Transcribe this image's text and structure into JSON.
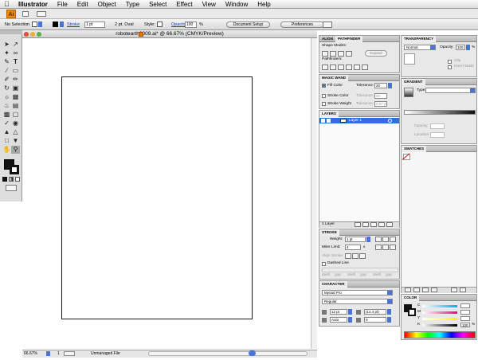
{
  "menubar": {
    "app": "Illustrator",
    "items": [
      "File",
      "Edit",
      "Object",
      "Type",
      "Select",
      "Effect",
      "View",
      "Window",
      "Help"
    ]
  },
  "appbar": {
    "logo": "Ai"
  },
  "control": {
    "selection": "No Selection",
    "stroke_label": "Stroke",
    "stroke_weight": "1 pt",
    "brush": "2 pt. Oval",
    "style_label": "Style:",
    "opacity_label": "Opacity:",
    "opacity_value": "100",
    "percent": "%",
    "document_setup": "Document Setup",
    "preferences": "Preferences"
  },
  "document": {
    "tab_title": "robotearth3009.ai* @ 66.67% (CMYK/Preview)"
  },
  "status": {
    "zoom": "66.67%",
    "page": "1",
    "info": "Unmanaged File"
  },
  "align_panel": {
    "tabs": [
      "ALIGN",
      "PATHFINDER"
    ],
    "shape_modes": "Shape Modes:",
    "expand": "Expand",
    "pathfinders": "Pathfinders:"
  },
  "magic_wand": {
    "title": "MAGIC WAND",
    "fill_color": "Fill Color",
    "tolerance": "Tolerance:",
    "tolerance_value": "20",
    "stroke_color": "Stroke Color",
    "stroke_tolerance": "20",
    "stroke_weight": "Stroke Weight",
    "weight_tolerance": "0.07 pt"
  },
  "transparency": {
    "title": "TRANSPARENCY",
    "mode": "Normal",
    "opacity_label": "Opacity:",
    "opacity_value": "100",
    "percent": "%",
    "clip": "Clip",
    "invert_mask": "Invert Mask"
  },
  "gradient": {
    "title": "GRADIENT",
    "type_label": "Type:",
    "opacity": "Opacity:",
    "location": "Location:"
  },
  "swatches": {
    "title": "SWATCHES"
  },
  "layers": {
    "title": "LAYERS",
    "layer_name": "Layer 1",
    "count": "1 Layer"
  },
  "stroke_panel": {
    "title": "STROKE",
    "weight_label": "Weight:",
    "weight_value": "1 pt",
    "miter_label": "Miter Limit:",
    "miter_value": "4",
    "miter_x": "x",
    "align_label": "Align Stroke:",
    "dashed": "Dashed Line",
    "dash_labels": [
      "dash",
      "gap",
      "dash",
      "gap",
      "dash",
      "gap"
    ]
  },
  "character": {
    "title": "CHARACTER",
    "font": "Myriad Pro",
    "style": "Regular",
    "size": "12 pt",
    "leading": "(14.4 pt)",
    "kerning": "Auto",
    "tracking": "0"
  },
  "color_panel": {
    "title": "COLOR",
    "channels": [
      "C",
      "M",
      "Y",
      "K"
    ],
    "k_value": "100",
    "percent": "%"
  },
  "colors": {
    "accent": "#4a73d6",
    "logo": "#f08a00",
    "panel_bg": "#e8e8e8",
    "layer_selected": "#2f6fe0"
  }
}
